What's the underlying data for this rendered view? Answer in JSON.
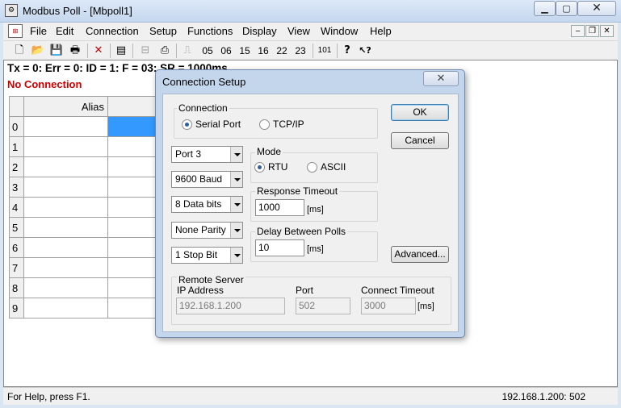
{
  "window": {
    "title": "Modbus Poll - [Mbpoll1]",
    "min_glyph": "▁",
    "max_glyph": "▢",
    "close_glyph": "✕"
  },
  "menu": {
    "items": [
      "File",
      "Edit",
      "Connection",
      "Setup",
      "Functions",
      "Display",
      "View",
      "Window",
      "Help"
    ],
    "mdi_min": "‒",
    "mdi_restore": "❐",
    "mdi_close": "✕"
  },
  "toolbar": {
    "new_glyph": "🗋",
    "open_glyph": "📂",
    "save_glyph": "💾",
    "print_glyph": "🖶",
    "delete_glyph": "✕",
    "window_glyph": "▤",
    "pulse_glyph": "⎍",
    "function_codes": [
      "05",
      "06",
      "15",
      "16",
      "22",
      "23"
    ],
    "code_101": "101",
    "help_glyph": "?",
    "context_help_glyph": "↖?"
  },
  "child": {
    "status_line": "Tx = 0: Err = 0: ID = 1: F = 03: SR = 1000ms",
    "connection_state": "No Connection",
    "grid": {
      "alias_header": "Alias",
      "rows": [
        "0",
        "1",
        "2",
        "3",
        "4",
        "5",
        "6",
        "7",
        "8",
        "9"
      ]
    }
  },
  "statusbar": {
    "help": "For Help, press F1.",
    "address": "192.168.1.200: 502"
  },
  "dialog": {
    "title": "Connection Setup",
    "close_glyph": "✕",
    "connection": {
      "label": "Connection",
      "serial_label": "Serial Port",
      "tcp_label": "TCP/IP",
      "selected": "Serial Port"
    },
    "serial": {
      "port": "Port 3",
      "baud": "9600 Baud",
      "data_bits": "8 Data bits",
      "parity": "None Parity",
      "stop_bits": "1 Stop Bit"
    },
    "mode": {
      "label": "Mode",
      "rtu_label": "RTU",
      "ascii_label": "ASCII",
      "selected": "RTU"
    },
    "response_timeout": {
      "label": "Response Timeout",
      "value": "1000",
      "unit": "[ms]"
    },
    "delay_between_polls": {
      "label": "Delay Between Polls",
      "value": "10",
      "unit": "[ms]"
    },
    "remote_server": {
      "label": "Remote Server",
      "ip_label": "IP Address",
      "ip_value": "192.168.1.200",
      "port_label": "Port",
      "port_value": "502",
      "timeout_label": "Connect Timeout",
      "timeout_value": "3000",
      "timeout_unit": "[ms]"
    },
    "buttons": {
      "ok": "OK",
      "cancel": "Cancel",
      "advanced": "Advanced..."
    }
  }
}
